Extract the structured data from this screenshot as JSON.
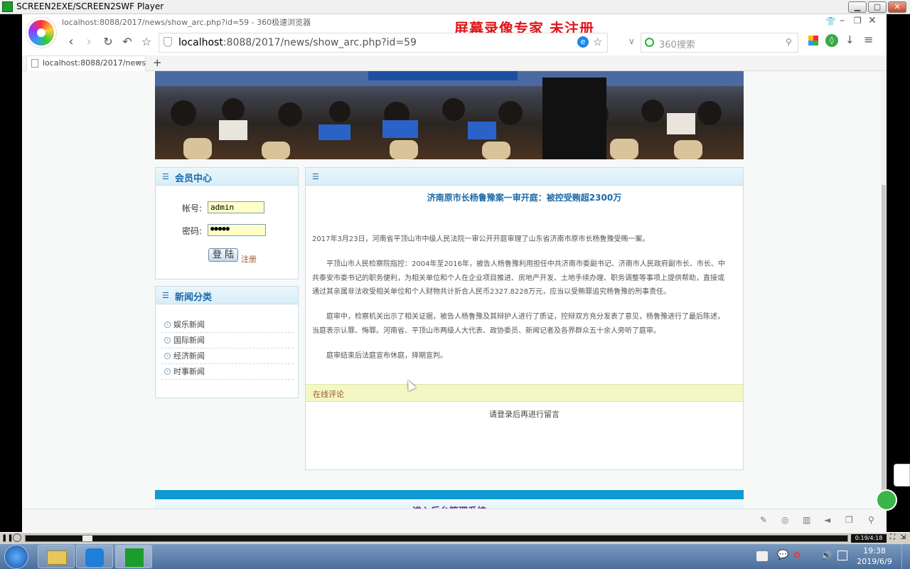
{
  "player": {
    "title": "SCREEN2EXE/SCREEN2SWF Player",
    "time": "0:19/4:18",
    "progress_fraction": 0.07
  },
  "browser": {
    "window_title": "localhost:8088/2017/news/show_arc.php?id=59 - 360极速浏览器",
    "watermark": "屏幕录像专家  未注册",
    "url_host": "localhost",
    "url_rest": ":8088/2017/news/show_arc.php?id=59",
    "search_placeholder": "360搜索",
    "tab_label": "localhost:8088/2017/news"
  },
  "sidebar": {
    "member_title": "会员中心",
    "username_label": "帐号:",
    "username_value": "admin",
    "password_label": "密码:",
    "password_value": "●●●●●",
    "login_button": "登 陆",
    "register_link": "注册",
    "category_title": "新闻分类",
    "categories": [
      "娱乐新闻",
      "国际新闻",
      "经济新闻",
      "时事新闻"
    ]
  },
  "article": {
    "title": "济南原市长杨鲁豫案一审开庭：被控受贿超2300万",
    "paragraphs": [
      "2017年3月23日，河南省平顶山市中级人民法院一审公开开庭审理了山东省济南市原市长杨鲁豫受贿一案。",
      "平顶山市人民检察院指控：2004年至2016年，被告人杨鲁豫利用担任中共济南市委副书记、济南市人民政府副市长、市长、中共泰安市委书记的职务便利，为相关单位和个人在企业项目推进、房地产开发、土地手续办理、职务调整等事项上提供帮助，直接或通过其亲属非法收受相关单位和个人财物共计折合人民币2327.8228万元，应当以受贿罪追究杨鲁豫的刑事责任。",
      "庭审中，检察机关出示了相关证据，被告人杨鲁豫及其辩护人进行了质证，控辩双方充分发表了意见，杨鲁豫进行了最后陈述，当庭表示认罪、悔罪。河南省、平顶山市两级人大代表、政协委员、新闻记者及各界群众五十余人旁听了庭审。",
      "庭审结束后法庭宣布休庭，择期宣判。"
    ],
    "comments_header": "在线评论",
    "comments_prompt": "请登录后再进行留言"
  },
  "footer": {
    "admin_link": "进入后台管理系统"
  },
  "taskbar": {
    "time": "19:38",
    "date": "2019/6/9"
  },
  "colors": {
    "accent": "#0f9ad3",
    "watermark": "#e0161a",
    "link": "#1a6aa8"
  }
}
